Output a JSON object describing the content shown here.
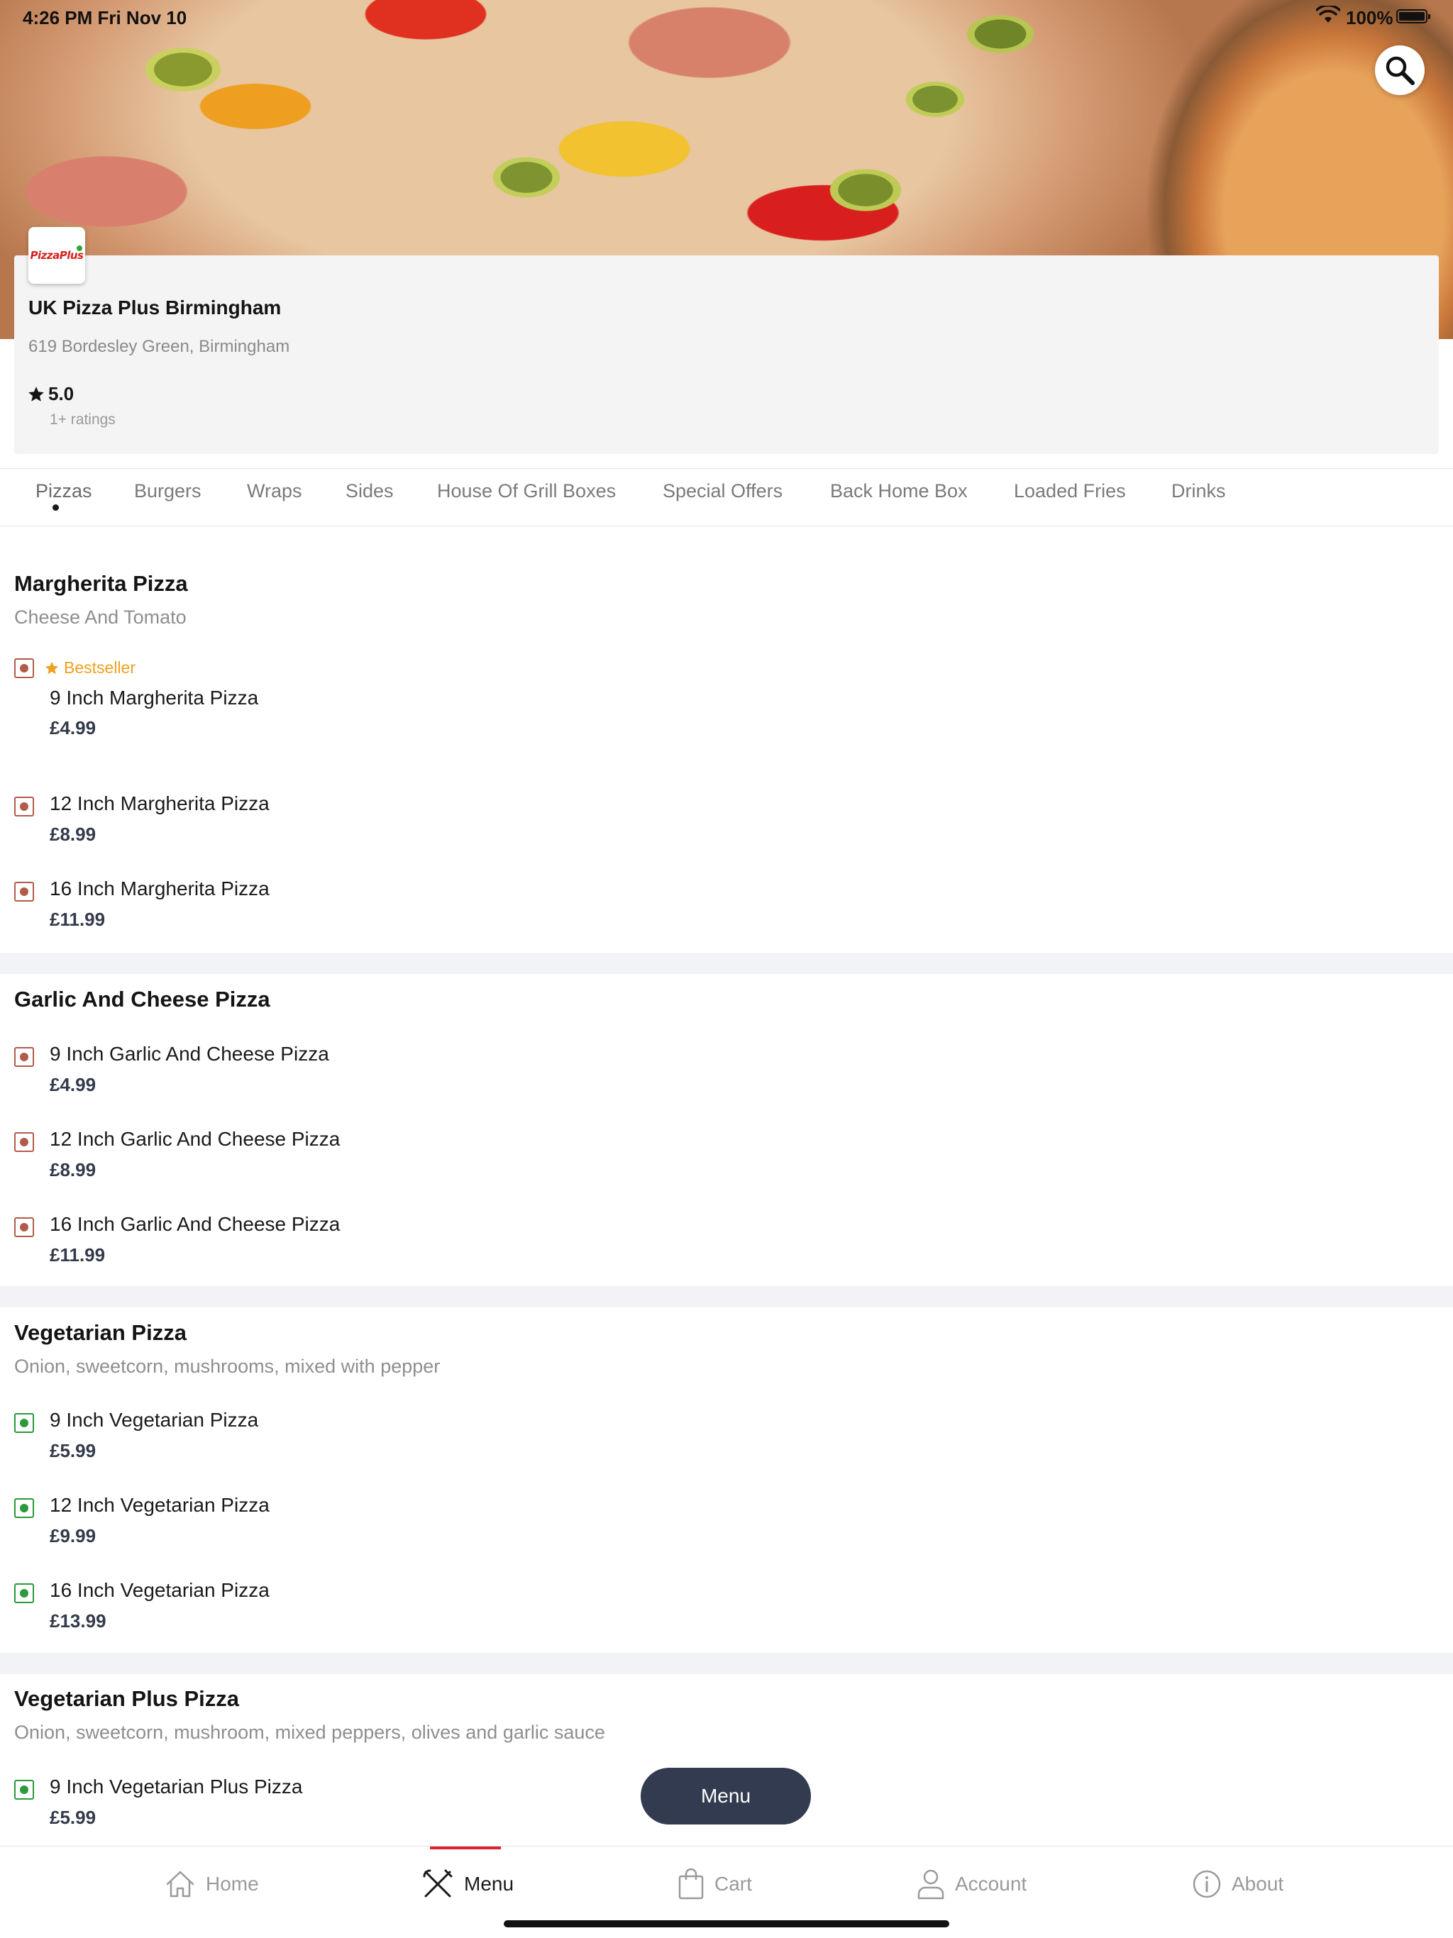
{
  "status_bar": {
    "time": "4:26 PM   Fri Nov 10",
    "battery": "100%"
  },
  "restaurant": {
    "logo_text": "PizzaPlus",
    "name": "UK Pizza Plus Birmingham",
    "address": "619 Bordesley Green, Birmingham",
    "rating": "5.0",
    "rating_count": "1+ ratings"
  },
  "tabs": [
    {
      "label": "Pizzas",
      "active": true
    },
    {
      "label": "Burgers"
    },
    {
      "label": "Wraps"
    },
    {
      "label": "Sides"
    },
    {
      "label": "House Of Grill Boxes"
    },
    {
      "label": "Special Offers"
    },
    {
      "label": "Back Home Box"
    },
    {
      "label": "Loaded Fries"
    },
    {
      "label": "Drinks"
    }
  ],
  "sections": [
    {
      "title": "Margherita Pizza",
      "description": "Cheese And Tomato",
      "items": [
        {
          "name": "9 Inch Margherita Pizza",
          "price": "£4.99",
          "badge": "Bestseller",
          "veg": false
        },
        {
          "name": "12 Inch Margherita Pizza",
          "price": "£8.99",
          "veg": false
        },
        {
          "name": "16 Inch Margherita Pizza",
          "price": "£11.99",
          "veg": false
        }
      ]
    },
    {
      "title": "Garlic And Cheese Pizza",
      "description": "",
      "items": [
        {
          "name": "9 Inch Garlic And Cheese Pizza",
          "price": "£4.99",
          "veg": false
        },
        {
          "name": "12 Inch Garlic And Cheese Pizza",
          "price": "£8.99",
          "veg": false
        },
        {
          "name": "16 Inch Garlic And Cheese Pizza",
          "price": "£11.99",
          "veg": false
        }
      ]
    },
    {
      "title": "Vegetarian Pizza",
      "description": "Onion, sweetcorn, mushrooms, mixed with pepper",
      "items": [
        {
          "name": "9 Inch Vegetarian Pizza",
          "price": "£5.99",
          "veg": true
        },
        {
          "name": "12 Inch Vegetarian Pizza",
          "price": "£9.99",
          "veg": true
        },
        {
          "name": "16 Inch Vegetarian Pizza",
          "price": "£13.99",
          "veg": true
        }
      ]
    },
    {
      "title": "Vegetarian Plus Pizza",
      "description": "Onion, sweetcorn, mushroom, mixed peppers, olives and garlic sauce",
      "items": [
        {
          "name": "9 Inch Vegetarian Plus Pizza",
          "price": "£5.99",
          "veg": true
        }
      ]
    }
  ],
  "floating_button": "Menu",
  "bottom_nav": [
    {
      "label": "Home",
      "icon": "home-icon"
    },
    {
      "label": "Menu",
      "icon": "utensils-icon",
      "active": true
    },
    {
      "label": "Cart",
      "icon": "bag-icon"
    },
    {
      "label": "Account",
      "icon": "user-icon"
    },
    {
      "label": "About",
      "icon": "info-icon"
    }
  ],
  "colors": {
    "accent": "#e02030",
    "button": "#333b50",
    "nonveg": "#b25b4a",
    "veg": "#2a9a3a",
    "bestseller": "#f0a020"
  }
}
